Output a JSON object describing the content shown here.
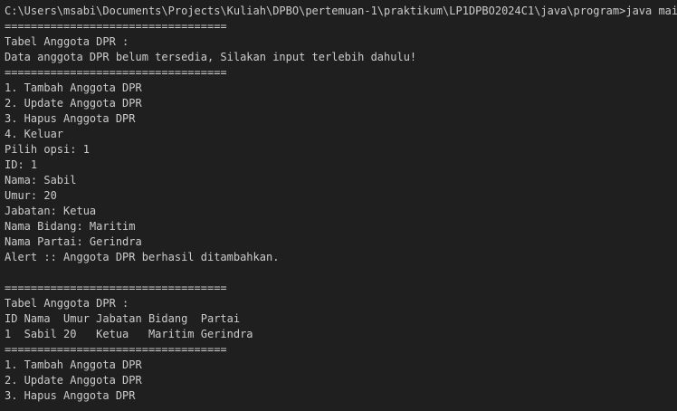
{
  "terminal": {
    "lines": [
      "C:\\Users\\msabi\\Documents\\Projects\\Kuliah\\DPBO\\pertemuan-1\\praktikum\\LP1DPBO2024C1\\java\\program>java main",
      "==================================",
      "Tabel Anggota DPR :",
      "Data anggota DPR belum tersedia, Silakan input terlebih dahulu!",
      "==================================",
      "1. Tambah Anggota DPR",
      "2. Update Anggota DPR",
      "3. Hapus Anggota DPR",
      "4. Keluar",
      "Pilih opsi: 1",
      "ID: 1",
      "Nama: Sabil",
      "Umur: 20",
      "Jabatan: Ketua",
      "Nama Bidang: Maritim",
      "Nama Partai: Gerindra",
      "Alert :: Anggota DPR berhasil ditambahkan.",
      "",
      "==================================",
      "Tabel Anggota DPR :",
      "ID Nama  Umur Jabatan Bidang  Partai",
      "1  Sabil 20   Ketua   Maritim Gerindra",
      "==================================",
      "1. Tambah Anggota DPR",
      "2. Update Anggota DPR",
      "3. Hapus Anggota DPR"
    ]
  }
}
